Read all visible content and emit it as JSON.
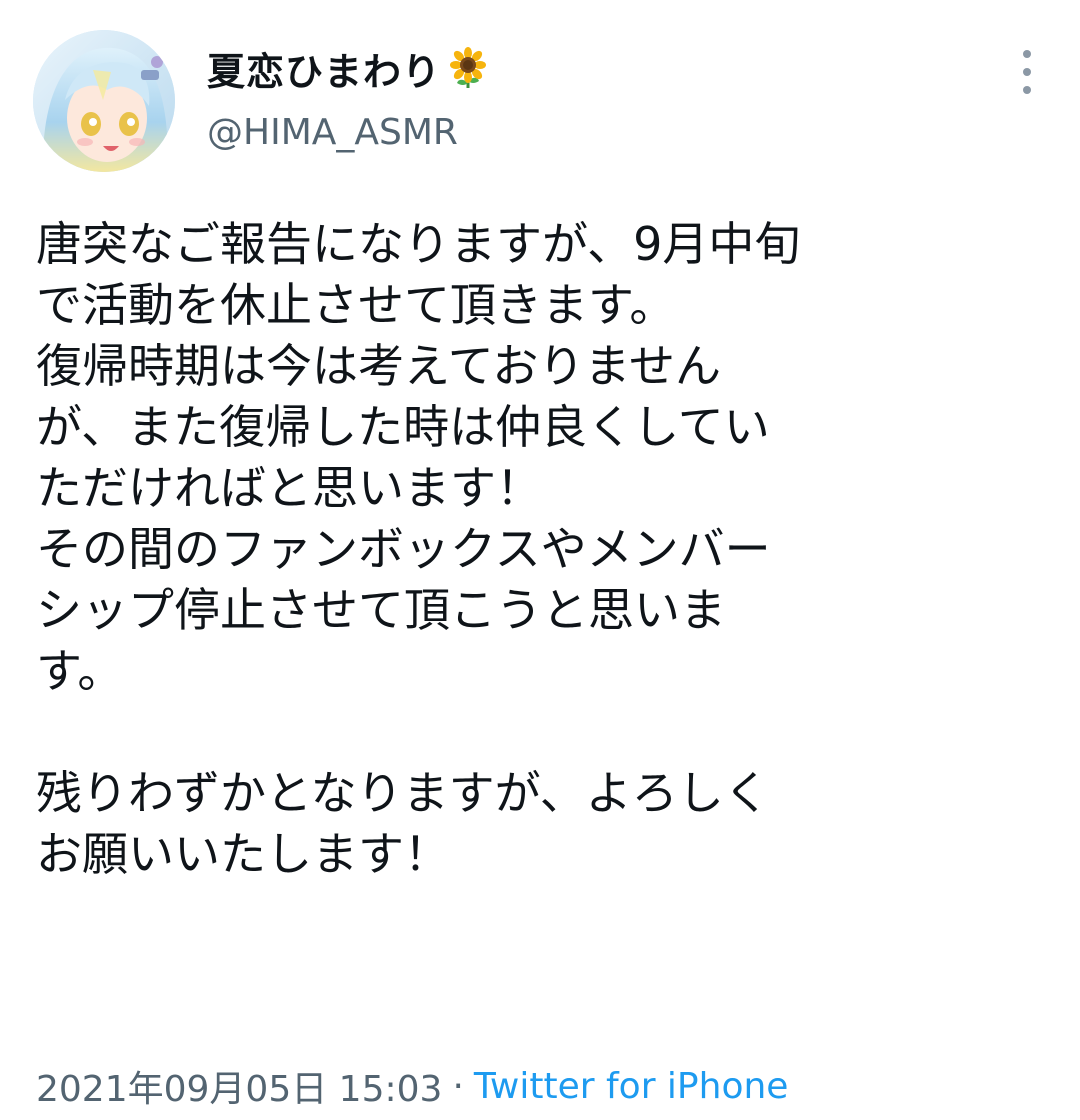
{
  "user": {
    "display_name": "夏恋ひまわり",
    "name_emoji_icon": "sunflower-icon",
    "handle": "@HIMA_ASMR"
  },
  "tweet": {
    "lines": [
      "唐突なご報告になりますが、9月中旬",
      "で活動を休止させて頂きます。",
      "復帰時期は今は考えておりません",
      "が、また復帰した時は仲良くしてい",
      "ただければと思います！",
      "その間のファンボックスやメンバー",
      "シップ停止させて頂こうと思いま",
      "す。",
      "",
      "残りわずかとなりますが、よろしく",
      "お願いいたします！"
    ]
  },
  "meta": {
    "timestamp": "2021年09月05日 15:03",
    "separator": "·",
    "source": "Twitter for iPhone"
  },
  "colors": {
    "text": "#0f1419",
    "secondary": "#536471",
    "link": "#1d9bf0"
  }
}
